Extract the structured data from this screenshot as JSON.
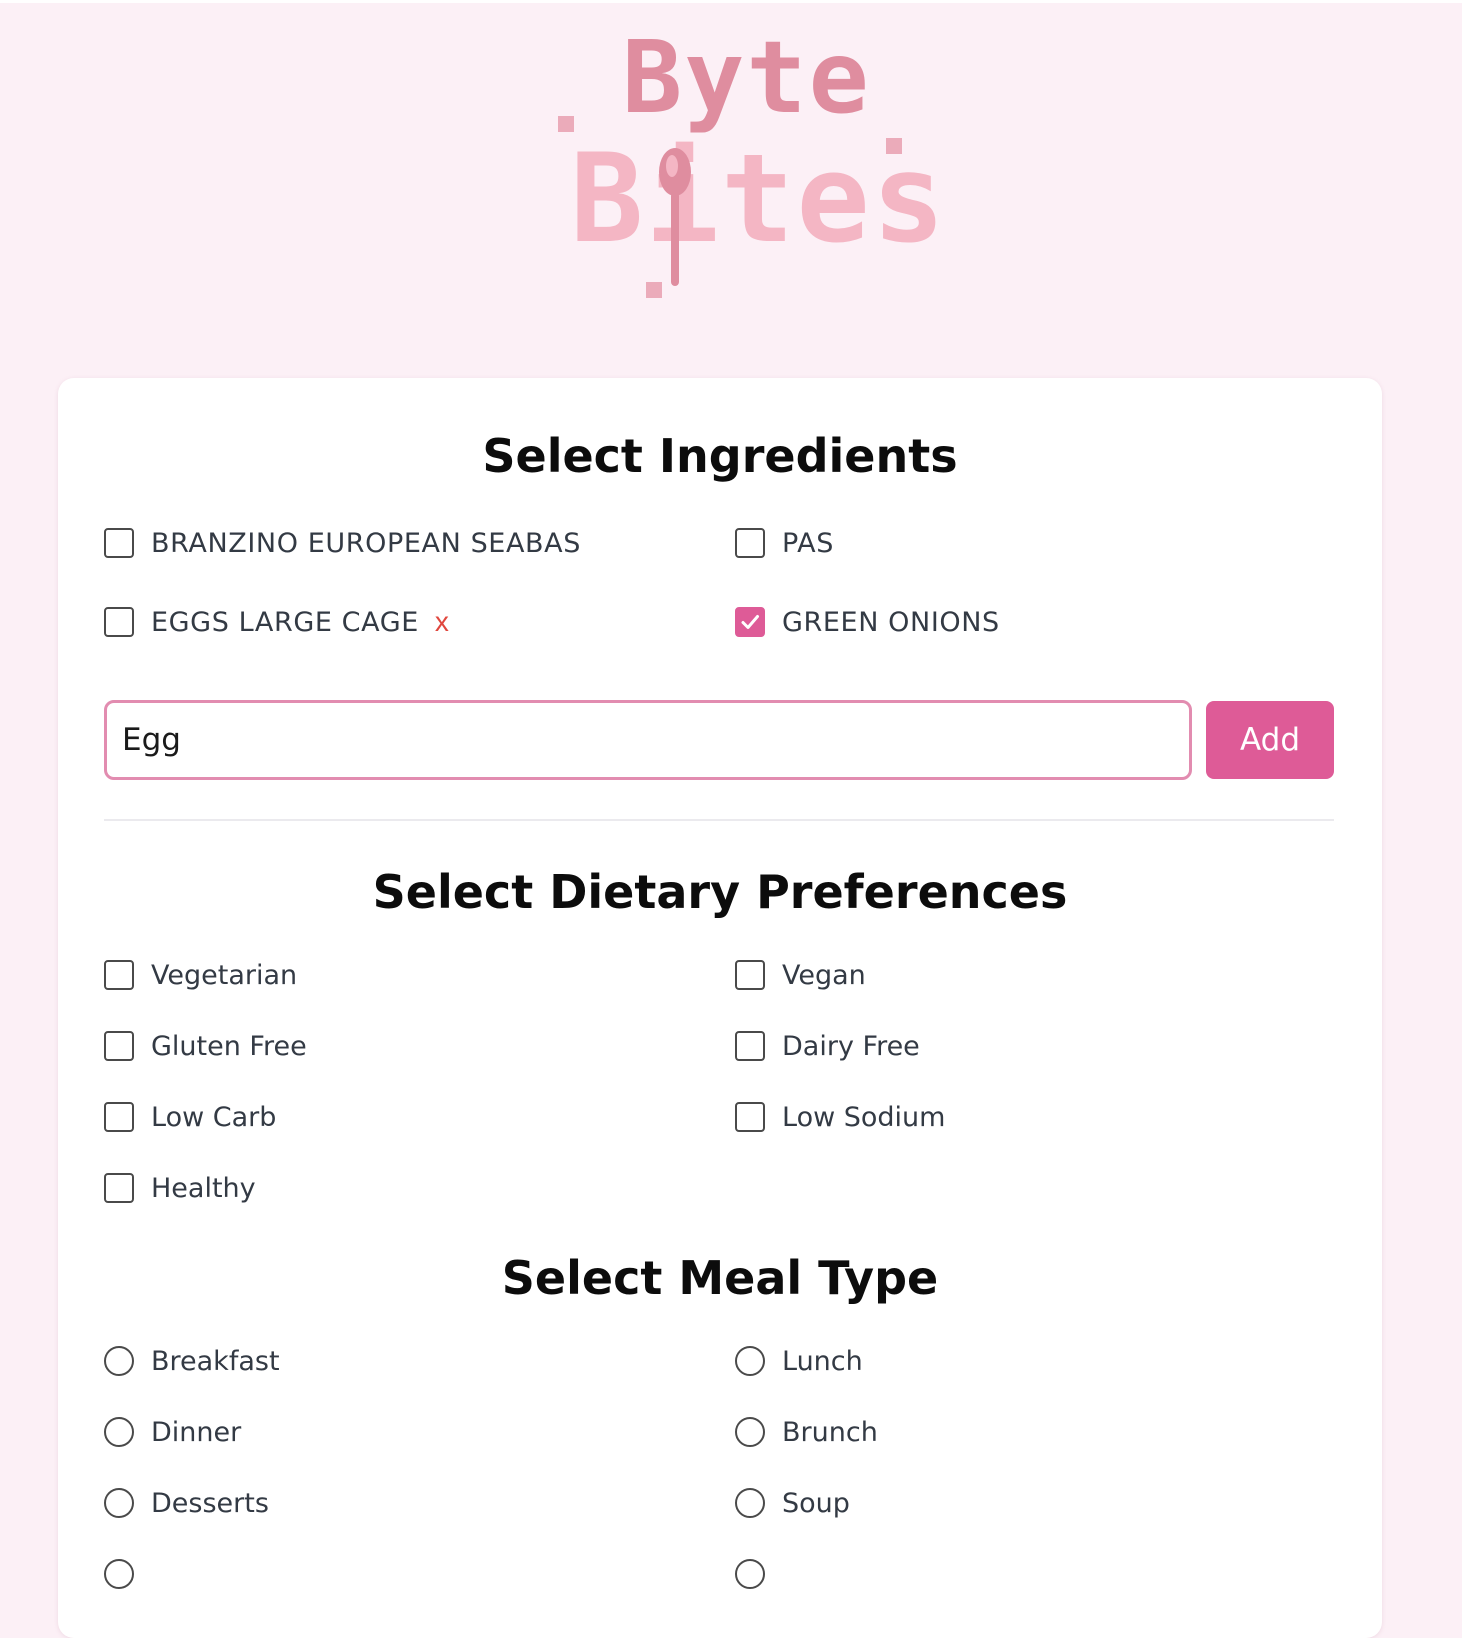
{
  "brand": {
    "logo_line1": "Byte",
    "logo_line2": "Bites"
  },
  "ingredients_section": {
    "title": "Select Ingredients",
    "items": [
      {
        "label": "BRANZINO EUROPEAN SEABAS",
        "checked": false,
        "removable": false
      },
      {
        "label": "PAS",
        "checked": false,
        "removable": false
      },
      {
        "label": "EGGS LARGE CAGE",
        "checked": false,
        "removable": true
      },
      {
        "label": "GREEN ONIONS",
        "checked": true,
        "removable": false
      }
    ],
    "remove_glyph": "x",
    "input_value": "Egg",
    "add_button_label": "Add"
  },
  "dietary_section": {
    "title": "Select Dietary Preferences",
    "items": [
      {
        "label": "Vegetarian",
        "checked": false
      },
      {
        "label": "Vegan",
        "checked": false
      },
      {
        "label": "Gluten Free",
        "checked": false
      },
      {
        "label": "Dairy Free",
        "checked": false
      },
      {
        "label": "Low Carb",
        "checked": false
      },
      {
        "label": "Low Sodium",
        "checked": false
      },
      {
        "label": "Healthy",
        "checked": false
      }
    ]
  },
  "meal_type_section": {
    "title": "Select Meal Type",
    "items": [
      {
        "label": "Breakfast",
        "selected": false
      },
      {
        "label": "Lunch",
        "selected": false
      },
      {
        "label": "Dinner",
        "selected": false
      },
      {
        "label": "Brunch",
        "selected": false
      },
      {
        "label": "Desserts",
        "selected": false
      },
      {
        "label": "Soup",
        "selected": false
      }
    ]
  },
  "colors": {
    "page_background": "#fcf0f6",
    "accent": "#de5b97",
    "input_border": "#e28cb0",
    "remove_red": "#e0473e",
    "logo_dark_pink": "#df8d9f",
    "logo_light_pink": "#f4b6c4"
  },
  "icons": {
    "check": "check-icon",
    "spoon": "spoon-icon"
  }
}
